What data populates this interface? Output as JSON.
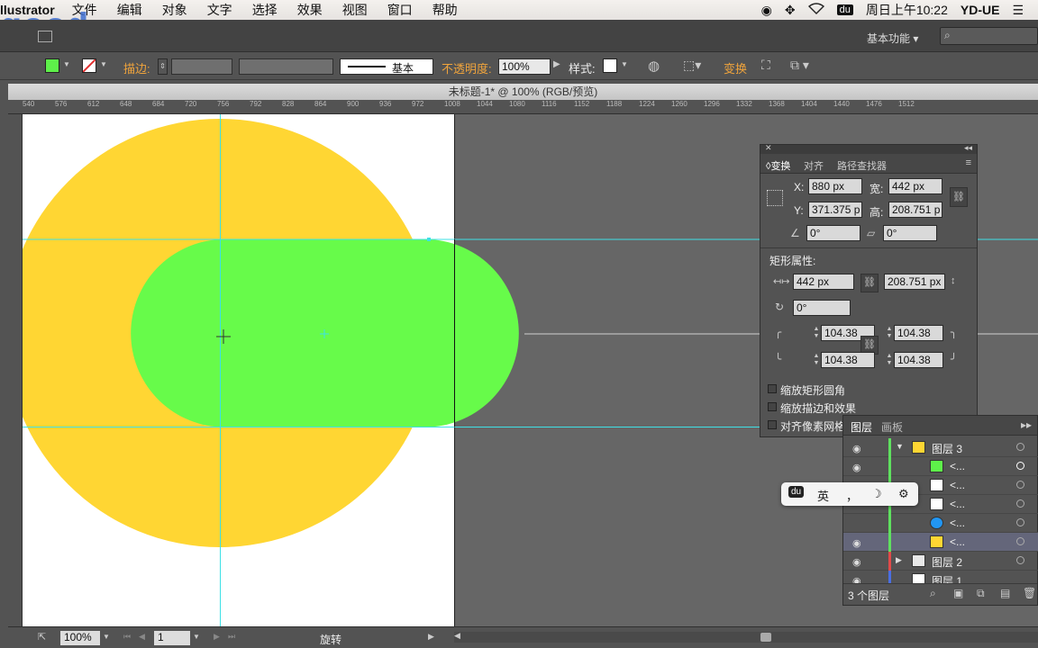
{
  "menubar": {
    "app": "llustrator",
    "items": [
      "文件",
      "编辑",
      "对象",
      "文字",
      "选择",
      "效果",
      "视图",
      "窗口",
      "帮助"
    ],
    "clock": "周日上午10:22",
    "user": "YD-UE",
    "ime_badge": "du"
  },
  "watermark": "good",
  "appbar": {
    "workspace": "基本功能"
  },
  "control": {
    "fill_color": "#5ef04a",
    "stroke_label": "描边:",
    "stroke_style": "基本",
    "opacity_label": "不透明度:",
    "opacity_value": "100%",
    "style_label": "样式:",
    "transform_label": "变换"
  },
  "document": {
    "title": "未标题-1* @ 100% (RGB/预览)",
    "ruler_ticks": [
      "540",
      "576",
      "612",
      "648",
      "684",
      "720",
      "756",
      "792",
      "828",
      "864",
      "900",
      "936",
      "972",
      "1008",
      "1044",
      "1080",
      "1116",
      "1152",
      "1188",
      "1224",
      "1260",
      "1296",
      "1332",
      "1368",
      "1404",
      "1440",
      "1476",
      "1512"
    ]
  },
  "transform_panel": {
    "tabs": [
      "变换",
      "对齐",
      "路径查找器"
    ],
    "x_label": "X:",
    "x_value": "880 px",
    "y_label": "Y:",
    "y_value": "371.375 p",
    "w_label": "宽:",
    "w_value": "442 px",
    "h_label": "高:",
    "h_value": "208.751 p",
    "angle_value": "0°",
    "shear_value": "0°",
    "rect_props_label": "矩形属性:",
    "rect_w": "442 px",
    "rect_h": "208.751 px",
    "rect_rotation": "0°",
    "corner_tl": "104.38",
    "corner_tr": "104.38",
    "corner_bl": "104.38",
    "corner_br": "104.38",
    "opt_scale_corners": "缩放矩形圆角",
    "opt_scale_strokes": "缩放描边和效果",
    "opt_align_pixel": "对齐像素网格"
  },
  "layers_panel": {
    "tabs": [
      "图层",
      "画板"
    ],
    "rows": [
      {
        "name": "图层 3",
        "thumb": "#ffd633"
      },
      {
        "name": "<...",
        "thumb": "#5ef04a"
      },
      {
        "name": "<...",
        "thumb": "#ffffff"
      },
      {
        "name": "<...",
        "thumb": "#ffffff"
      },
      {
        "name": "<...",
        "thumb": "#2196f3"
      },
      {
        "name": "<...",
        "thumb": "#ffd633"
      },
      {
        "name": "图层 2",
        "thumb": "#e8e8e8"
      },
      {
        "name": "图层 1",
        "thumb": "#ffffff"
      }
    ],
    "footer": "3 个图层"
  },
  "ime_bar": {
    "lang": "英",
    "punct": "，",
    "moon": "☽",
    "gear": "⚙"
  },
  "statusbar": {
    "zoom": "100%",
    "page": "1",
    "tool": "旋转"
  },
  "colors": {
    "yellow_circle": "#ffd633",
    "green_capsule": "#67fb4a",
    "guide": "#3ee0e6"
  }
}
